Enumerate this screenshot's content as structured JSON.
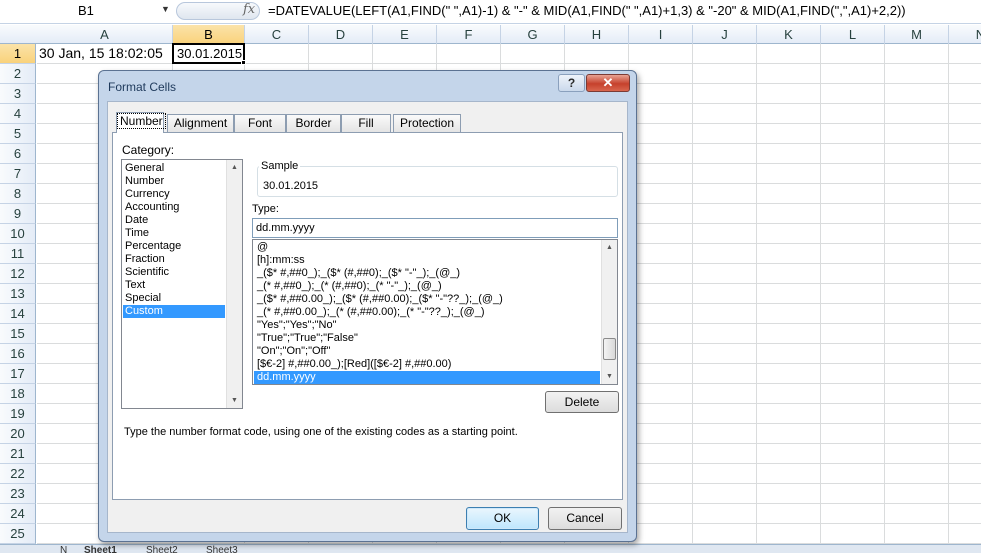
{
  "formula_bar": {
    "name_box": "B1",
    "fx_icon": "fx-icon",
    "formula": "=DATEVALUE(LEFT(A1,FIND(\" \",A1)-1) & \"-\" & MID(A1,FIND(\" \",A1)+1,3) & \"-20\" & MID(A1,FIND(\",\",A1)+2,2))"
  },
  "sheet": {
    "columns": [
      "A",
      "B",
      "C",
      "D",
      "E",
      "F",
      "G",
      "H",
      "I",
      "J",
      "K",
      "L",
      "M",
      "N"
    ],
    "rows": [
      "1",
      "2",
      "3",
      "4",
      "5",
      "6",
      "7",
      "8",
      "9",
      "10",
      "11",
      "12",
      "13",
      "14",
      "15",
      "16",
      "17",
      "18",
      "19",
      "20",
      "21",
      "22",
      "23",
      "24",
      "25"
    ],
    "selected_column": "B",
    "selected_row": "1",
    "cell_a1": "30 Jan, 15 18:02:05",
    "cell_b1": "30.01.2015",
    "sheet_tabs": [
      "N",
      "Sheet1",
      "Sheet2",
      "Sheet3"
    ]
  },
  "dialog": {
    "title": "Format Cells",
    "help_label": "?",
    "close_label": "✕",
    "tabs": [
      "Number",
      "Alignment",
      "Font",
      "Border",
      "Fill",
      "Protection"
    ],
    "active_tab": "Number",
    "category_label": "Category:",
    "categories": [
      "General",
      "Number",
      "Currency",
      "Accounting",
      "Date",
      "Time",
      "Percentage",
      "Fraction",
      "Scientific",
      "Text",
      "Special",
      "Custom"
    ],
    "selected_category": "Custom",
    "sample_label": "Sample",
    "sample_value": "30.01.2015",
    "type_label": "Type:",
    "type_value": "dd.mm.yyyy",
    "format_codes": [
      "@",
      "[h]:mm:ss",
      "_($* #,##0_);_($* (#,##0);_($* \"-\"_);_(@_)",
      "_(* #,##0_);_(* (#,##0);_(* \"-\"_);_(@_)",
      "_($* #,##0.00_);_($* (#,##0.00);_($* \"-\"??_);_(@_)",
      "_(* #,##0.00_);_(* (#,##0.00);_(* \"-\"??_);_(@_)",
      "\"Yes\";\"Yes\";\"No\"",
      "\"True\";\"True\";\"False\"",
      "\"On\";\"On\";\"Off\"",
      "[$€-2] #,##0.00_);[Red]([$€-2] #,##0.00)",
      "dd.mm.yyyy"
    ],
    "selected_format": "dd.mm.yyyy",
    "delete_label": "Delete",
    "hint": "Type the number format code, using one of the existing codes as a starting point.",
    "ok_label": "OK",
    "cancel_label": "Cancel"
  }
}
